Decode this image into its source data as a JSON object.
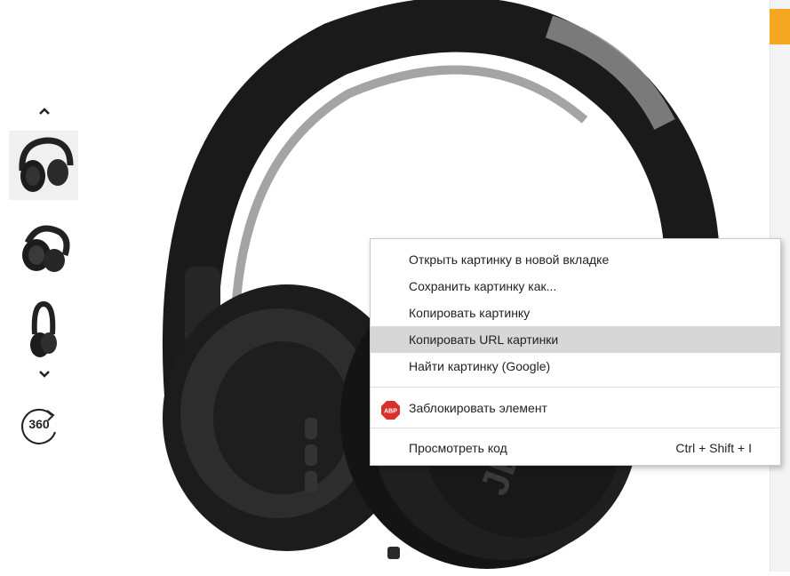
{
  "page": {
    "accent_color": "#f5a623"
  },
  "gallery": {
    "up_icon": "chevron-up-icon",
    "down_icon": "chevron-down-icon",
    "thumbnails": [
      "headphones-front-thumbnail",
      "headphones-folded-thumbnail",
      "headphones-side-thumbnail"
    ],
    "view360_label": "360"
  },
  "context_menu": {
    "items": [
      {
        "label": "Открыть картинку в новой вкладке"
      },
      {
        "label": "Сохранить картинку как..."
      },
      {
        "label": "Копировать картинку"
      },
      {
        "label": "Копировать URL картинки",
        "highlighted": true
      },
      {
        "label": "Найти картинку (Google)"
      }
    ],
    "abp_item": {
      "icon_text": "ABP",
      "label": "Заблокировать элемент"
    },
    "inspect_item": {
      "label": "Просмотреть код",
      "shortcut": "Ctrl + Shift + I"
    }
  }
}
